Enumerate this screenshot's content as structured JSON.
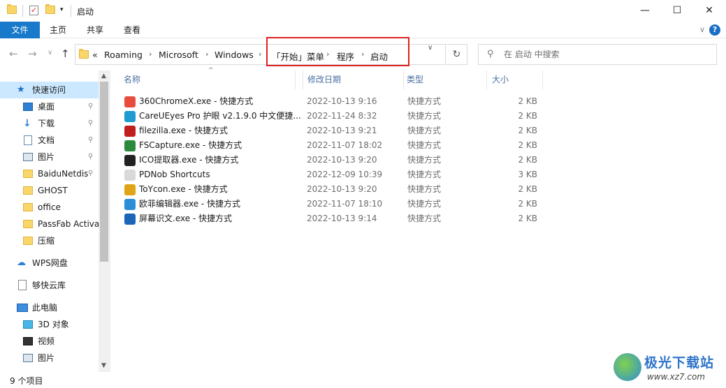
{
  "window": {
    "title": "启动",
    "min_glyph": "—",
    "max_glyph": "☐",
    "close_glyph": "✕"
  },
  "ribbon": {
    "tabs": [
      "文件",
      "主页",
      "共享",
      "查看"
    ],
    "help": "?",
    "collapse_glyph": "∨"
  },
  "nav": {
    "back": "←",
    "forward": "→",
    "recent": "∨",
    "up": "↑"
  },
  "address": {
    "overflow": "«",
    "segments": [
      "Roaming",
      "Microsoft",
      "Windows",
      "「开始」菜单",
      "程序",
      "启动"
    ],
    "separator": "›",
    "dropdown": "∨",
    "refresh": "↻"
  },
  "search": {
    "placeholder": "在 启动 中搜索",
    "icon": "search-icon"
  },
  "navpane": {
    "items": [
      {
        "label": "快速访问",
        "icon": "star-icon",
        "pinned": false
      },
      {
        "label": "桌面",
        "icon": "desktop-icon",
        "pinned": true
      },
      {
        "label": "下载",
        "icon": "download-icon",
        "pinned": true
      },
      {
        "label": "文档",
        "icon": "documents-icon",
        "pinned": true
      },
      {
        "label": "图片",
        "icon": "pictures-icon",
        "pinned": true
      },
      {
        "label": "BaiduNetdis",
        "icon": "folder-icon",
        "pinned": true
      },
      {
        "label": "GHOST",
        "icon": "folder-icon",
        "pinned": false
      },
      {
        "label": "office",
        "icon": "folder-icon",
        "pinned": false
      },
      {
        "label": "PassFab Activa",
        "icon": "folder-icon",
        "pinned": false
      },
      {
        "label": "压缩",
        "icon": "folder-icon",
        "pinned": false
      },
      {
        "label": "WPS网盘",
        "icon": "cloud-icon",
        "pinned": false
      },
      {
        "label": "够快云库",
        "icon": "file-icon",
        "pinned": false
      },
      {
        "label": "此电脑",
        "icon": "computer-icon",
        "pinned": false
      },
      {
        "label": "3D 对象",
        "icon": "cube-icon",
        "pinned": false
      },
      {
        "label": "视频",
        "icon": "video-icon",
        "pinned": false
      },
      {
        "label": "图片",
        "icon": "pictures-icon",
        "pinned": false
      }
    ],
    "pin_glyph": "📌"
  },
  "columns": [
    "名称",
    "修改日期",
    "类型",
    "大小"
  ],
  "files": [
    {
      "name": "360ChromeX.exe - 快捷方式",
      "date": "2022-10-13 9:16",
      "type": "快捷方式",
      "size": "2 KB",
      "color": "#e84c3d"
    },
    {
      "name": "CareUEyes Pro 护眼 v2.1.9.0 中文便捷...",
      "date": "2022-11-24 8:32",
      "type": "快捷方式",
      "size": "2 KB",
      "color": "#1f9bd1"
    },
    {
      "name": "filezilla.exe - 快捷方式",
      "date": "2022-10-13 9:21",
      "type": "快捷方式",
      "size": "2 KB",
      "color": "#bf1e1e"
    },
    {
      "name": "FSCapture.exe - 快捷方式",
      "date": "2022-11-07 18:02",
      "type": "快捷方式",
      "size": "2 KB",
      "color": "#2c8a3c"
    },
    {
      "name": "ICO提取器.exe - 快捷方式",
      "date": "2022-10-13 9:20",
      "type": "快捷方式",
      "size": "2 KB",
      "color": "#222222"
    },
    {
      "name": "PDNob Shortcuts",
      "date": "2022-12-09 10:39",
      "type": "快捷方式",
      "size": "3 KB",
      "color": "#d9d9d9"
    },
    {
      "name": "ToYcon.exe - 快捷方式",
      "date": "2022-10-13 9:20",
      "type": "快捷方式",
      "size": "2 KB",
      "color": "#e0a418"
    },
    {
      "name": "欧菲编辑器.exe - 快捷方式",
      "date": "2022-11-07 18:10",
      "type": "快捷方式",
      "size": "2 KB",
      "color": "#2a8fd6"
    },
    {
      "name": "屏幕识文.exe - 快捷方式",
      "date": "2022-10-13 9:14",
      "type": "快捷方式",
      "size": "2 KB",
      "color": "#1b66b8"
    }
  ],
  "status": {
    "count": "9 个项目"
  },
  "watermark": {
    "brand": "极光下载站",
    "url": "www.xz7.com"
  },
  "colors": {
    "accent": "#1979ca",
    "highlight_box": "#e02020",
    "selected": "#cce8ff"
  }
}
